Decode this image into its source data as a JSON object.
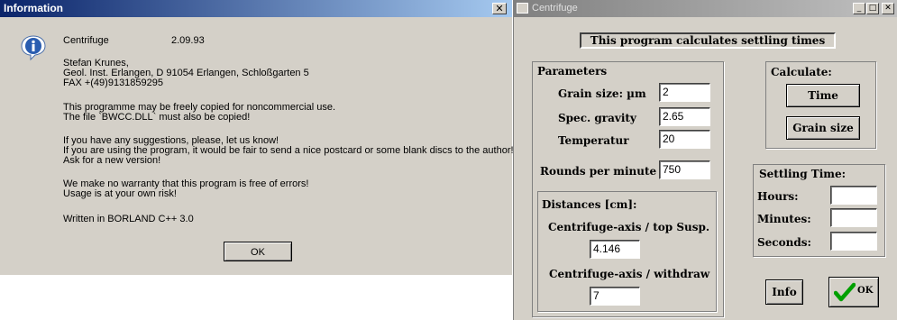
{
  "info_dialog": {
    "title": "Information",
    "close_glyph": "✕",
    "icon": "info-icon",
    "app_name": "Centrifuge",
    "version": "2.09.93",
    "author_name": "Stefan Krunes,",
    "address": "Geol. Inst. Erlangen, D 91054 Erlangen,  Schloßgarten 5",
    "fax": "FAX +(49)9131859295",
    "copy_line1": "This programme may be freely copied for noncommercial use.",
    "copy_line2": "The file `BWCC.DLL` must also be copied!",
    "suggest_line1": "If you have any suggestions, please, let us know!",
    "suggest_line2": "If you are using the program, it would be fair to send a nice postcard  or some blank discs to the author!",
    "suggest_line3": "Ask for a new version!",
    "warranty_line1": "We make no warranty that this program is free of errors!",
    "warranty_line2": "Usage is at your own risk!",
    "written_in": "Written in BORLAND C++ 3.0",
    "ok_label": "OK"
  },
  "centrifuge_window": {
    "title": "Centrifuge",
    "title_buttons": [
      "_",
      "□",
      "✕"
    ],
    "banner": "This program calculates settling times",
    "parameters": {
      "heading": "Parameters",
      "grain_size_label": "Grain size: µm",
      "grain_size_value": "2",
      "spec_gravity_label": "Spec. gravity",
      "spec_gravity_value": "2.65",
      "temperature_label": "Temperatur",
      "temperature_value": "20",
      "rpm_label": "Rounds per minute",
      "rpm_value": "750"
    },
    "distances": {
      "heading": "Distances [cm]:",
      "top_susp_label": "Centrifuge-axis / top Susp.",
      "top_susp_value": "4.146",
      "withdraw_label": "Centrifuge-axis / withdraw",
      "withdraw_value": "7"
    },
    "calculate": {
      "heading": "Calculate:",
      "time_label": "Time",
      "grain_size_label": "Grain size"
    },
    "settling_time": {
      "heading": "Settling Time:",
      "hours_label": "Hours:",
      "hours_value": "",
      "minutes_label": "Minutes:",
      "minutes_value": "",
      "seconds_label": "Seconds:",
      "seconds_value": ""
    },
    "info_label": "Info",
    "ok_label": "OK",
    "ok_icon": "checkmark-icon",
    "accent_check_color": "#00a000"
  }
}
